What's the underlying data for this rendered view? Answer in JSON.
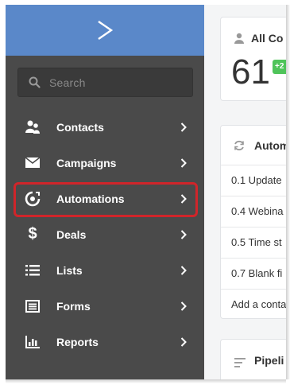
{
  "sidebar": {
    "search_placeholder": "Search",
    "items": [
      {
        "label": "Contacts",
        "icon": "contacts-icon"
      },
      {
        "label": "Campaigns",
        "icon": "envelope-icon"
      },
      {
        "label": "Automations",
        "icon": "automations-icon"
      },
      {
        "label": "Deals",
        "icon": "dollar-icon"
      },
      {
        "label": "Lists",
        "icon": "list-icon"
      },
      {
        "label": "Forms",
        "icon": "form-icon"
      },
      {
        "label": "Reports",
        "icon": "bar-chart-icon"
      }
    ]
  },
  "main": {
    "contacts_card": {
      "title": "All Co",
      "count": "61",
      "badge": "+2"
    },
    "automations_card": {
      "title": "Autom",
      "rows": [
        "0.1 Update",
        "0.4 Webina",
        "0.5 Time st",
        "0.7 Blank fi"
      ],
      "add_label": "Add a conta"
    },
    "pipelines_card": {
      "title": "Pipeli"
    }
  },
  "colors": {
    "logo_bar": "#5a88c9",
    "sidebar_bg": "#4a4a4a",
    "highlight": "#d0252a",
    "badge_green": "#4fc45a"
  }
}
